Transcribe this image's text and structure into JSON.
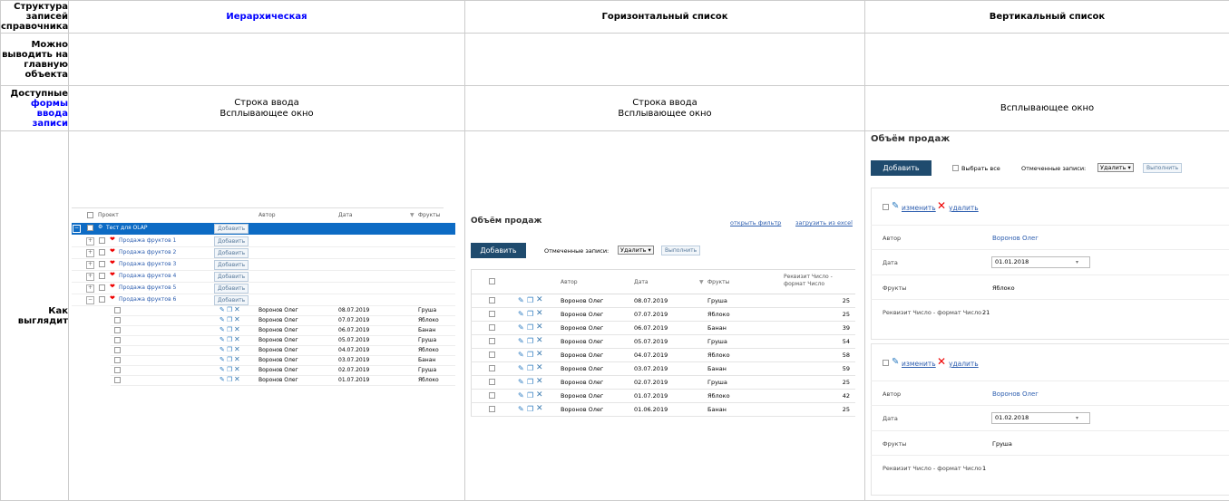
{
  "labels": {
    "row1": [
      "Структура",
      "записей",
      "справочника"
    ],
    "row2": [
      "Можно",
      "выводить на",
      "главную",
      "объекта"
    ],
    "row3_prefix": "Доступные",
    "row3_links": [
      "формы",
      "ввода",
      "записи"
    ],
    "row4": [
      "Как",
      "выглядит"
    ]
  },
  "headers": {
    "col1": "Иерархическая",
    "col2": "Горизонтальный список",
    "col3": "Вертикальный список"
  },
  "forms": {
    "col1_line1": "Строка ввода",
    "col1_line2": "Всплывающее окно",
    "col2_line1": "Строка ввода",
    "col2_line2": "Всплывающее окно",
    "col3": "Всплывающее окно"
  },
  "hier": {
    "columns": [
      "Проект",
      "Автор",
      "Дата",
      "Фрукты"
    ],
    "root": "Тест для OLAP",
    "add_label": "Добавить",
    "groups": [
      "Продажа фруктов 1",
      "Продажа фруктов 2",
      "Продажа фруктов 3",
      "Продажа фруктов 4",
      "Продажа фруктов 5",
      "Продажа фруктов 6"
    ],
    "rows": [
      {
        "author": "Воронов Олег",
        "date": "08.07.2019",
        "fruit": "Груша"
      },
      {
        "author": "Воронов Олег",
        "date": "07.07.2019",
        "fruit": "Яблоко"
      },
      {
        "author": "Воронов Олег",
        "date": "06.07.2019",
        "fruit": "Банан"
      },
      {
        "author": "Воронов Олег",
        "date": "05.07.2019",
        "fruit": "Груша"
      },
      {
        "author": "Воронов Олег",
        "date": "04.07.2019",
        "fruit": "Яблоко"
      },
      {
        "author": "Воронов Олег",
        "date": "03.07.2019",
        "fruit": "Банан"
      },
      {
        "author": "Воронов Олег",
        "date": "02.07.2019",
        "fruit": "Груша"
      },
      {
        "author": "Воронов Олег",
        "date": "01.07.2019",
        "fruit": "Яблоко"
      }
    ]
  },
  "horiz": {
    "title": "Объём продаж",
    "open_filter": "открыть фильтр",
    "export_excel": "загрузить из excel",
    "add_button": "Добавить",
    "marked_label": "Отмеченные записи:",
    "action_select": "Удалить",
    "execute": "Выполнить",
    "columns": [
      "Автор",
      "Дата",
      "Фрукты",
      "Реквизит Число -",
      "формат Число"
    ],
    "rows": [
      {
        "author": "Воронов Олег",
        "date": "08.07.2019",
        "fruit": "Груша",
        "num": "25"
      },
      {
        "author": "Воронов Олег",
        "date": "07.07.2019",
        "fruit": "Яблоко",
        "num": "25"
      },
      {
        "author": "Воронов Олег",
        "date": "06.07.2019",
        "fruit": "Банан",
        "num": "39"
      },
      {
        "author": "Воронов Олег",
        "date": "05.07.2019",
        "fruit": "Груша",
        "num": "54"
      },
      {
        "author": "Воронов Олег",
        "date": "04.07.2019",
        "fruit": "Яблоко",
        "num": "58"
      },
      {
        "author": "Воронов Олег",
        "date": "03.07.2019",
        "fruit": "Банан",
        "num": "59"
      },
      {
        "author": "Воронов Олег",
        "date": "02.07.2019",
        "fruit": "Груша",
        "num": "25"
      },
      {
        "author": "Воронов Олег",
        "date": "01.07.2019",
        "fruit": "Яблоко",
        "num": "42"
      },
      {
        "author": "Воронов Олег",
        "date": "01.06.2019",
        "fruit": "Банан",
        "num": "25"
      }
    ]
  },
  "vert": {
    "title": "Объём продаж",
    "add_button": "Добавить",
    "select_all": "Выбрать все",
    "marked_label": "Отмеченные записи:",
    "action_select": "Удалить",
    "execute": "Выполнить",
    "edit": "изменить",
    "delete": "удалить",
    "field_labels": [
      "Автор",
      "Дата",
      "Фрукты",
      "Реквизит Число - формат Число"
    ],
    "cards": [
      {
        "author": "Воронов Олег",
        "date": "01.01.2018",
        "fruit": "Яблоко",
        "num": "21"
      },
      {
        "author": "Воронов Олег",
        "date": "01.02.2018",
        "fruit": "Груша",
        "num": "1"
      }
    ]
  },
  "colors": {
    "selected_row": "#0d6bc4",
    "button_dark": "#1f4b6e",
    "link": "#3060b0",
    "header_link": "#0000ff"
  }
}
